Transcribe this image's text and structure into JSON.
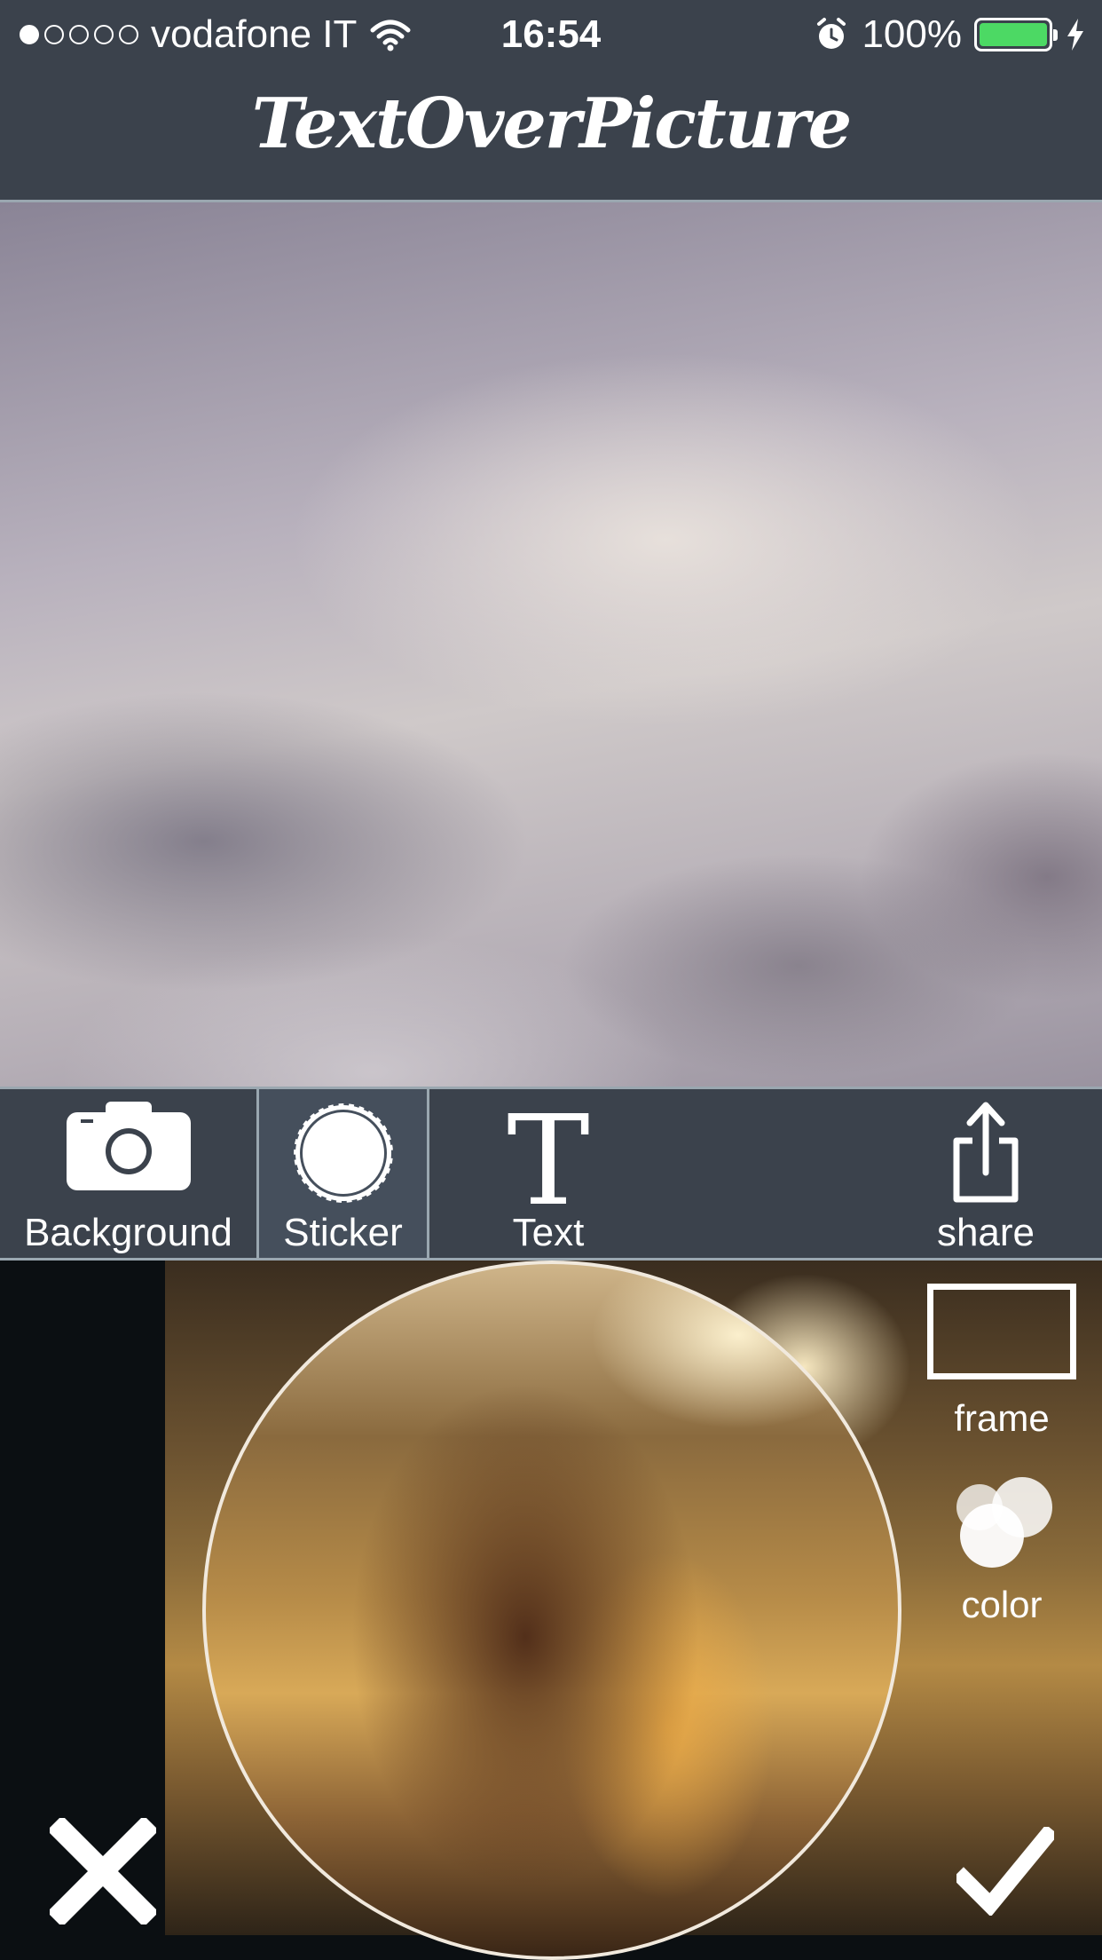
{
  "status_bar": {
    "signal_dots_filled": 1,
    "signal_dots_total": 5,
    "carrier": "vodafone IT",
    "time": "16:54",
    "battery": "100%",
    "battery_color": "#4cd964"
  },
  "header": {
    "title": "TextOverPicture"
  },
  "toolbar": {
    "items": [
      {
        "label": "Background",
        "icon": "camera-icon"
      },
      {
        "label": "Sticker",
        "icon": "sticker-icon",
        "selected": true
      },
      {
        "label": "Text",
        "icon": "text-t-icon",
        "glyph": "T"
      },
      {
        "label": "share",
        "icon": "share-icon"
      }
    ]
  },
  "editor": {
    "frame_label": "frame",
    "color_label": "color",
    "cancel_icon": "close-icon",
    "confirm_icon": "checkmark-icon"
  },
  "colors": {
    "bar": "#3b424c",
    "divider": "#9aa7b0",
    "selected_tool": "#454f5c"
  }
}
